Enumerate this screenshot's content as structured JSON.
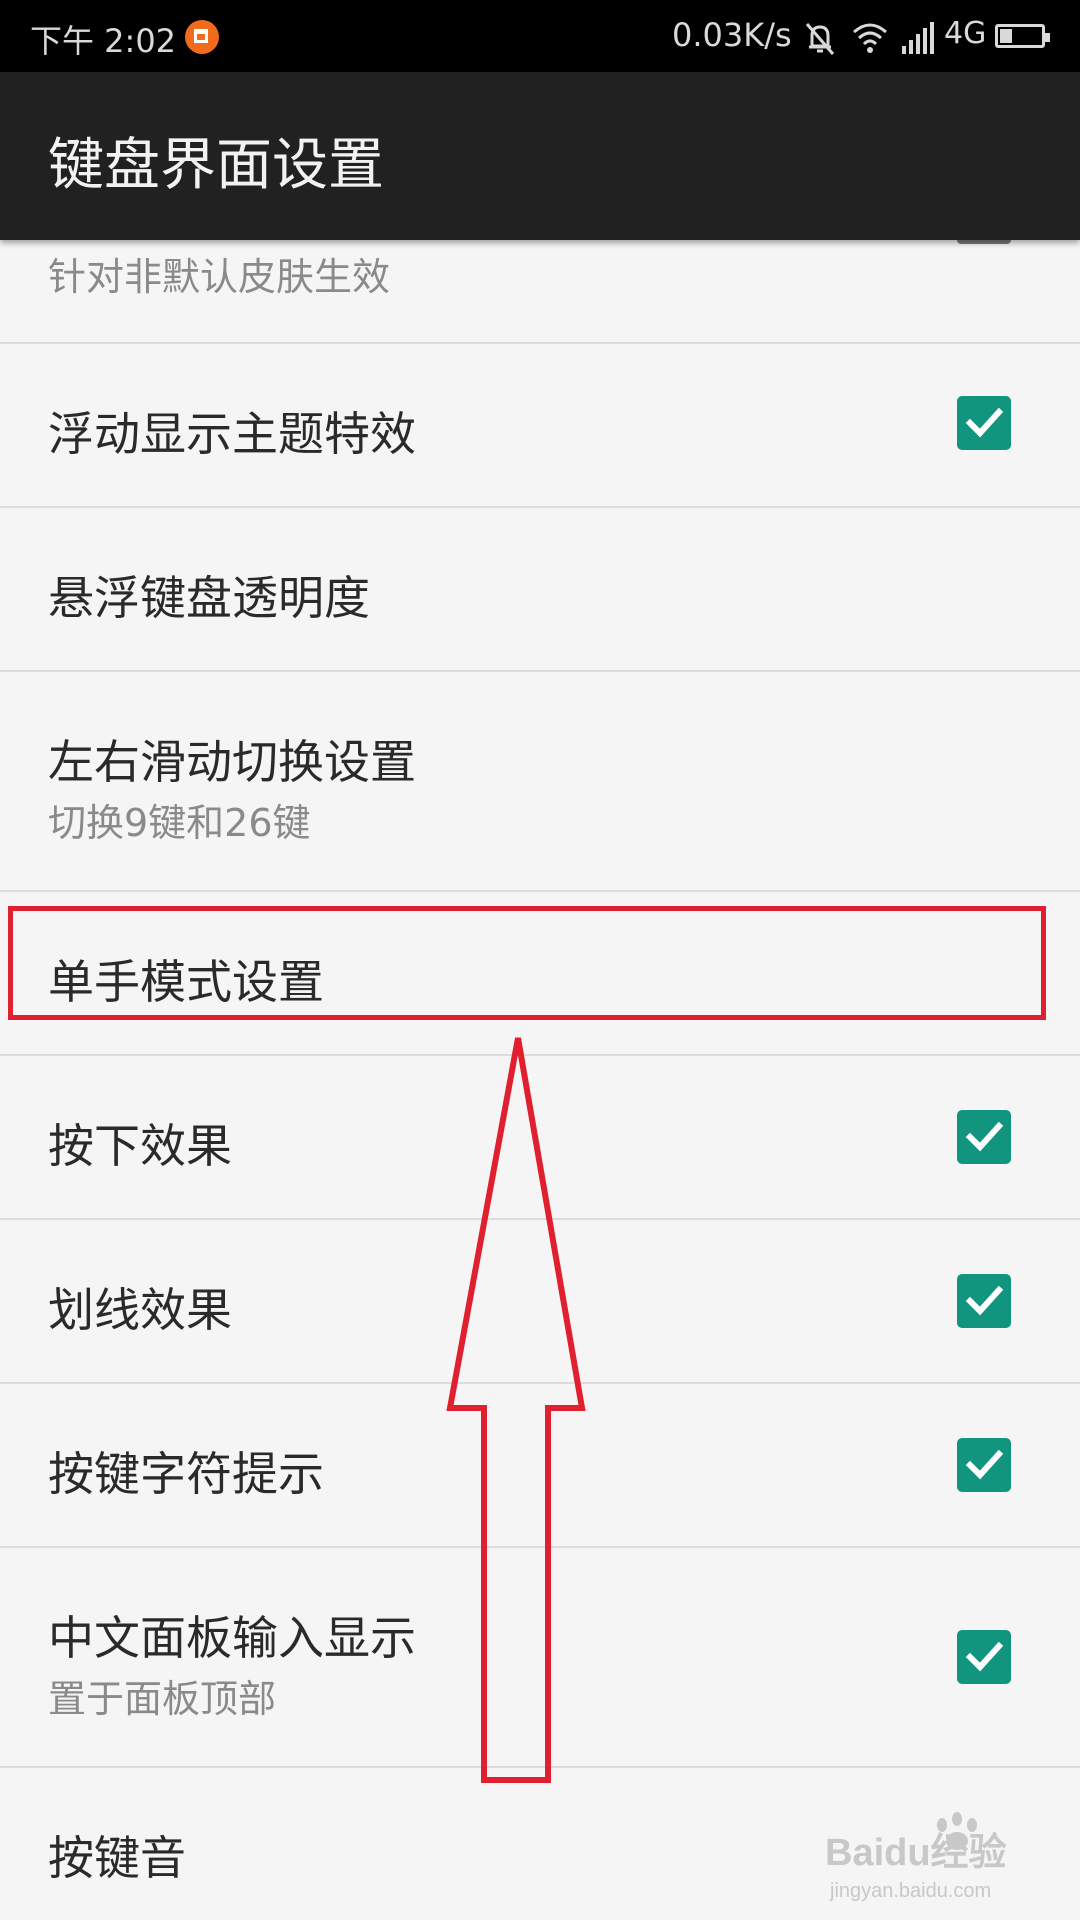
{
  "status_bar": {
    "time": "下午 2:02",
    "net_speed": "0.03K/s",
    "network": "4G",
    "icons": [
      "notification-app-icon",
      "mute-icon",
      "wifi-icon",
      "signal-icon",
      "battery-icon"
    ]
  },
  "app_bar": {
    "title": "键盘界面设置"
  },
  "items": [
    {
      "label": "",
      "summary": "针对非默认皮肤生效",
      "checkbox": "unchecked"
    },
    {
      "label": "浮动显示主题特效",
      "checkbox": "checked"
    },
    {
      "label": "悬浮键盘透明度"
    },
    {
      "label": "左右滑动切换设置",
      "summary": "切换9键和26键"
    },
    {
      "label": "单手模式设置"
    },
    {
      "label": "按下效果",
      "checkbox": "checked"
    },
    {
      "label": "划线效果",
      "checkbox": "checked"
    },
    {
      "label": "按键字符提示",
      "checkbox": "checked"
    },
    {
      "label": "中文面板输入显示",
      "summary": "置于面板顶部",
      "checkbox": "checked"
    },
    {
      "label": "按键音"
    }
  ],
  "annotation": {
    "highlight_color": "#e0202e",
    "checkbox_color": "#12957e"
  },
  "watermark": {
    "text": "Baidu经验",
    "url_text": "jingyan.baidu.com"
  }
}
